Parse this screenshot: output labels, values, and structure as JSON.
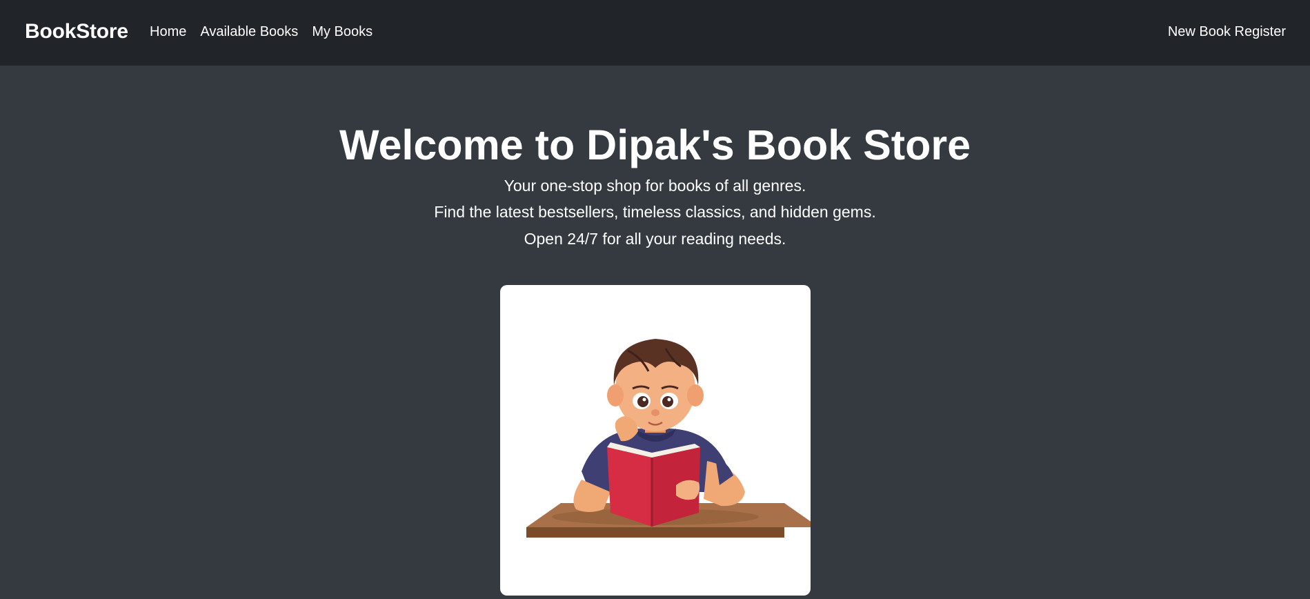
{
  "navbar": {
    "brand": "BookStore",
    "links": [
      {
        "label": "Home"
      },
      {
        "label": "Available Books"
      },
      {
        "label": "My Books"
      }
    ],
    "right_link": "New Book Register"
  },
  "hero": {
    "title": "Welcome to Dipak's Book Store",
    "lines": [
      "Your one-stop shop for books of all genres.",
      "Find the latest bestsellers, timeless classics, and hidden gems.",
      "Open 24/7 for all your reading needs."
    ]
  },
  "illustration": {
    "subject": "boy-reading-book-illustration"
  },
  "colors": {
    "navbar_bg": "#212529",
    "page_bg": "#343a40",
    "text": "#ffffff",
    "book_red": "#d62d45"
  }
}
